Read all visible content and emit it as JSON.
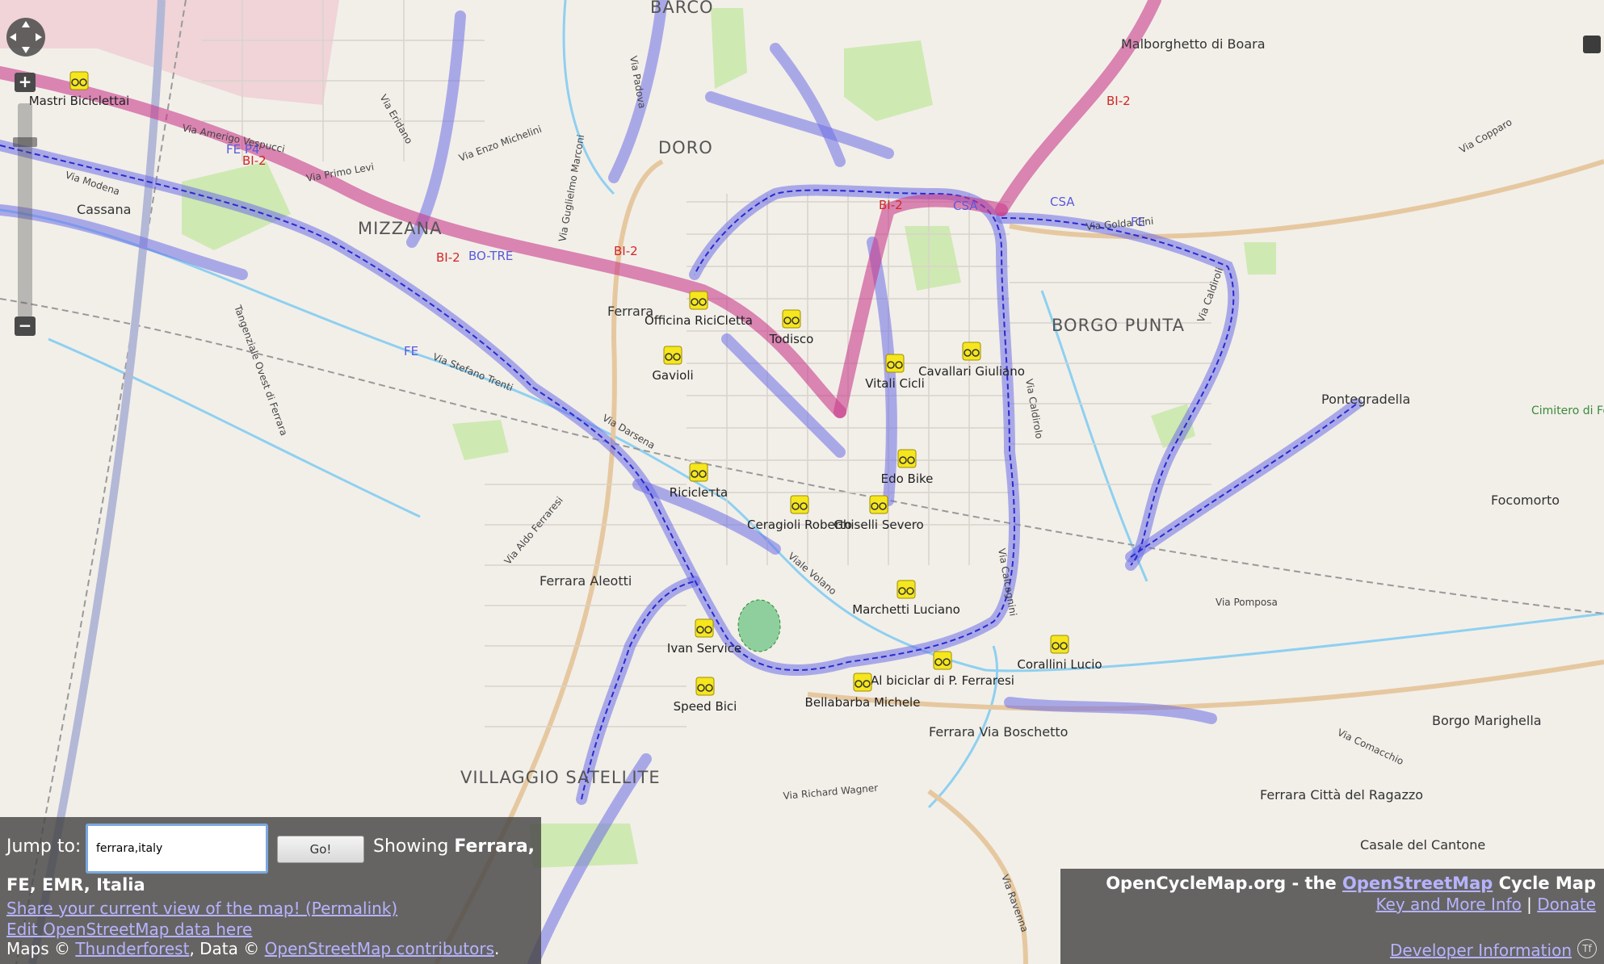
{
  "map": {
    "areas": [
      "BARCO",
      "DORO",
      "MIZZANA",
      "BORGO PUNTA",
      "VILLAGGIO SATELLITE"
    ],
    "places": [
      "Ferrara",
      "Cassana",
      "Malborghetto di Boara",
      "Pontegradella",
      "Focomorto",
      "Borgo Marighella",
      "Casale del Cantone",
      "Ferrara Città del Ragazzo",
      "Ferrara Via Boschetto",
      "Ferrara Aleotti",
      "Cimitero di Focomorto"
    ],
    "bike_shops": [
      "Mastri Biciclettai",
      "Officina RiciCletta",
      "Todisco",
      "Gavioli",
      "Vitali Cicli",
      "Cavallari Giuliano",
      "Riciclетta",
      "Edo Bike",
      "Ceragioli Roberto",
      "Ghiselli Severo",
      "Marchetti Luciano",
      "Ivan Service",
      "Corallini Lucio",
      "Al biciclar di P. Ferraresi",
      "Bellabarba Michele",
      "Speed Bici"
    ],
    "streets": [
      "Via Amerigo Vespucci",
      "Via Primo Levi",
      "Via Modena",
      "Via Eridano",
      "Via Enzo Michelini",
      "Via Guglielmo Marconi",
      "Via Padova",
      "Via Stefano Trenti",
      "Via Darsena",
      "Viale Volano",
      "Via Aldo Ferraresi",
      "Via Caldirolo",
      "Via Calcagnini",
      "Via Pomposa",
      "Via Comacchio",
      "Via Richard Wagner",
      "Via Ravenna",
      "Via Copparo",
      "Via Golda Cini",
      "Via Caldiroli",
      "Tangenziale Ovest di Ferrara"
    ],
    "route_refs": [
      "BI-2",
      "P4",
      "BO-TRE",
      "FE",
      "CSA"
    ],
    "colors": {
      "route_major": "#c83c8c",
      "route_local": "#5a5adc",
      "water": "#8fd0f0",
      "park": "#c8e6a6"
    }
  },
  "controls": {
    "zoom_in": "+",
    "zoom_out": "−"
  },
  "search": {
    "label": "Jump to:",
    "value": "ferrara,italy",
    "go_label": "Go!",
    "showing_prefix": "Showing ",
    "showing_place": "Ferrara,",
    "place_rest": "FE, EMR, Italia"
  },
  "links": {
    "permalink": "Share your current view of the map! (Permalink)",
    "edit": "Edit OpenStreetMap data here"
  },
  "credits": {
    "maps_prefix": "Maps © ",
    "thunderforest": "Thunderforest",
    "data_prefix": ", Data © ",
    "osm_contrib": "OpenStreetMap contributors",
    "period": "."
  },
  "header": {
    "title_prefix": "OpenCycleMap.org - the ",
    "osm": "OpenStreetMap",
    "title_suffix": " Cycle Map",
    "key_info": "Key and More Info",
    "sep": " | ",
    "donate": "Donate",
    "dev_info": "Developer Information"
  }
}
